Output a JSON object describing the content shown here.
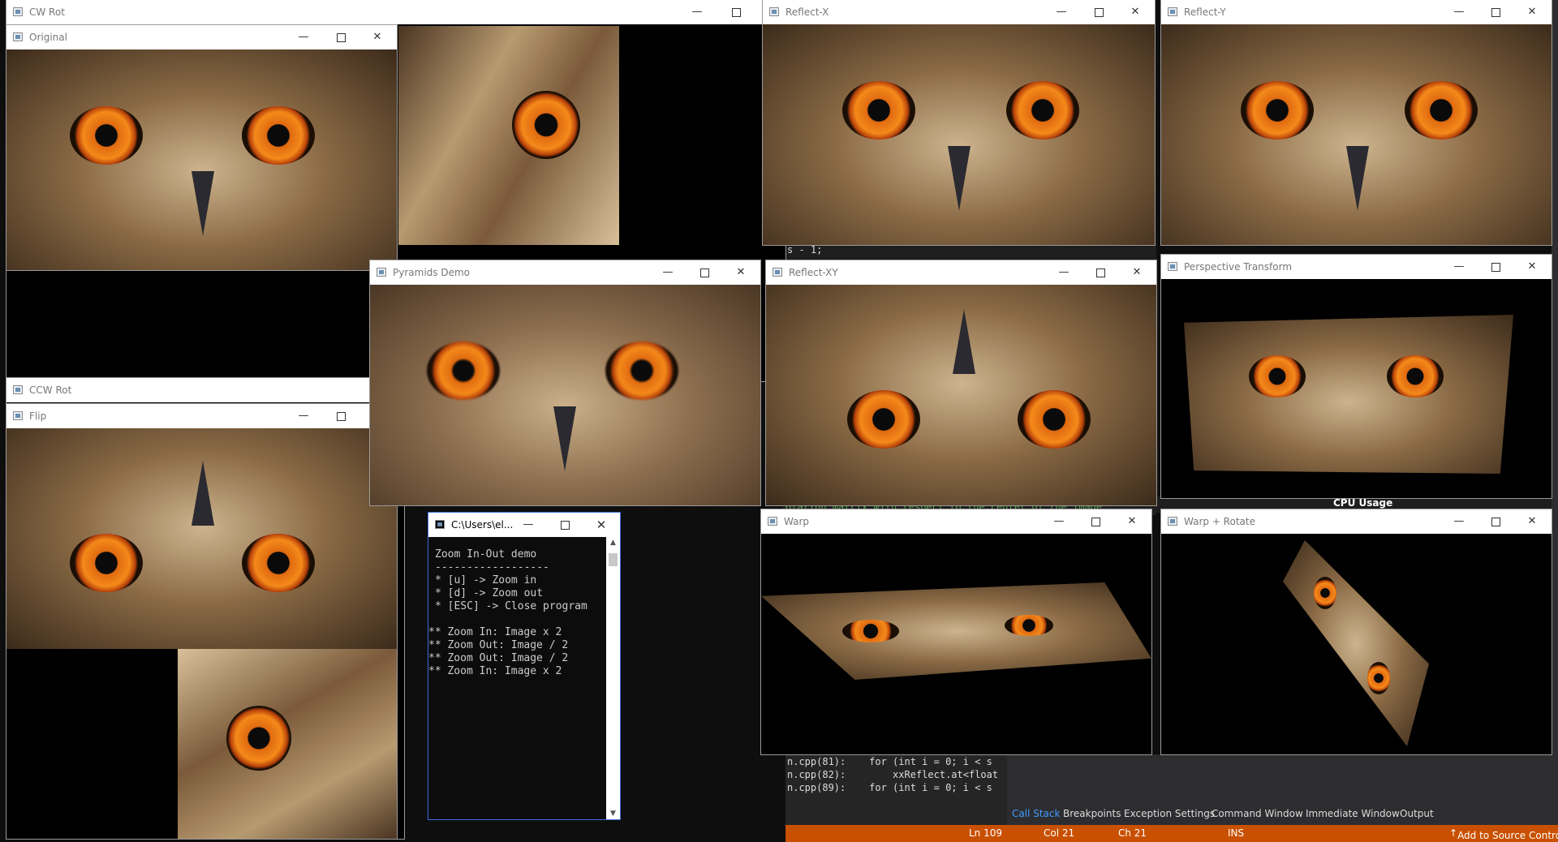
{
  "windows": {
    "cw_rot": {
      "title": "CW Rot"
    },
    "original": {
      "title": "Original"
    },
    "reflect_x": {
      "title": "Reflect-X"
    },
    "reflect_y": {
      "title": "Reflect-Y"
    },
    "pyramids": {
      "title": "Pyramids Demo"
    },
    "reflect_xy": {
      "title": "Reflect-XY"
    },
    "perspective": {
      "title": "Perspective Transform"
    },
    "ccw_rot": {
      "title": "CCW Rot"
    },
    "flip": {
      "title": "Flip"
    },
    "warp": {
      "title": "Warp"
    },
    "warp_rotate": {
      "title": "Warp + Rotate"
    },
    "console": {
      "title": "C:\\Users\\el...",
      "lines": [
        "Zoom In-Out demo",
        "------------------",
        "* [u] -> Zoom in",
        "* [d] -> Zoom out",
        "* [ESC] -> Close program",
        "",
        "** Zoom In: Image x 2",
        "** Zoom Out: Image / 2",
        "** Zoom Out: Image / 2",
        "** Zoom In: Image x 2"
      ]
    }
  },
  "ide": {
    "cpu_usage": "CPU Usage",
    "code_fragment_1": "s - 1;",
    "code_fragment_2": "otation matrix with respect to the center of the image",
    "call_stack_lines": [
      "n.cpp(81):    for (int i = 0; i < s",
      "n.cpp(82):        xxReflect.at<float",
      "n.cpp(89):    for (int i = 0; i < s"
    ],
    "tabs": [
      "Call Stack",
      "Breakpoints",
      "Exception Settings",
      "Command Window",
      "Immediate Window",
      "Output"
    ],
    "status": {
      "ln": "Ln 109",
      "col": "Col 21",
      "ch": "Ch 21",
      "ins": "INS",
      "source_control": "Add to Source Control"
    }
  },
  "colors": {
    "status_bar": "#c85000",
    "active_tab": "#3f9bff",
    "owl_iris": "#f58a1a"
  }
}
